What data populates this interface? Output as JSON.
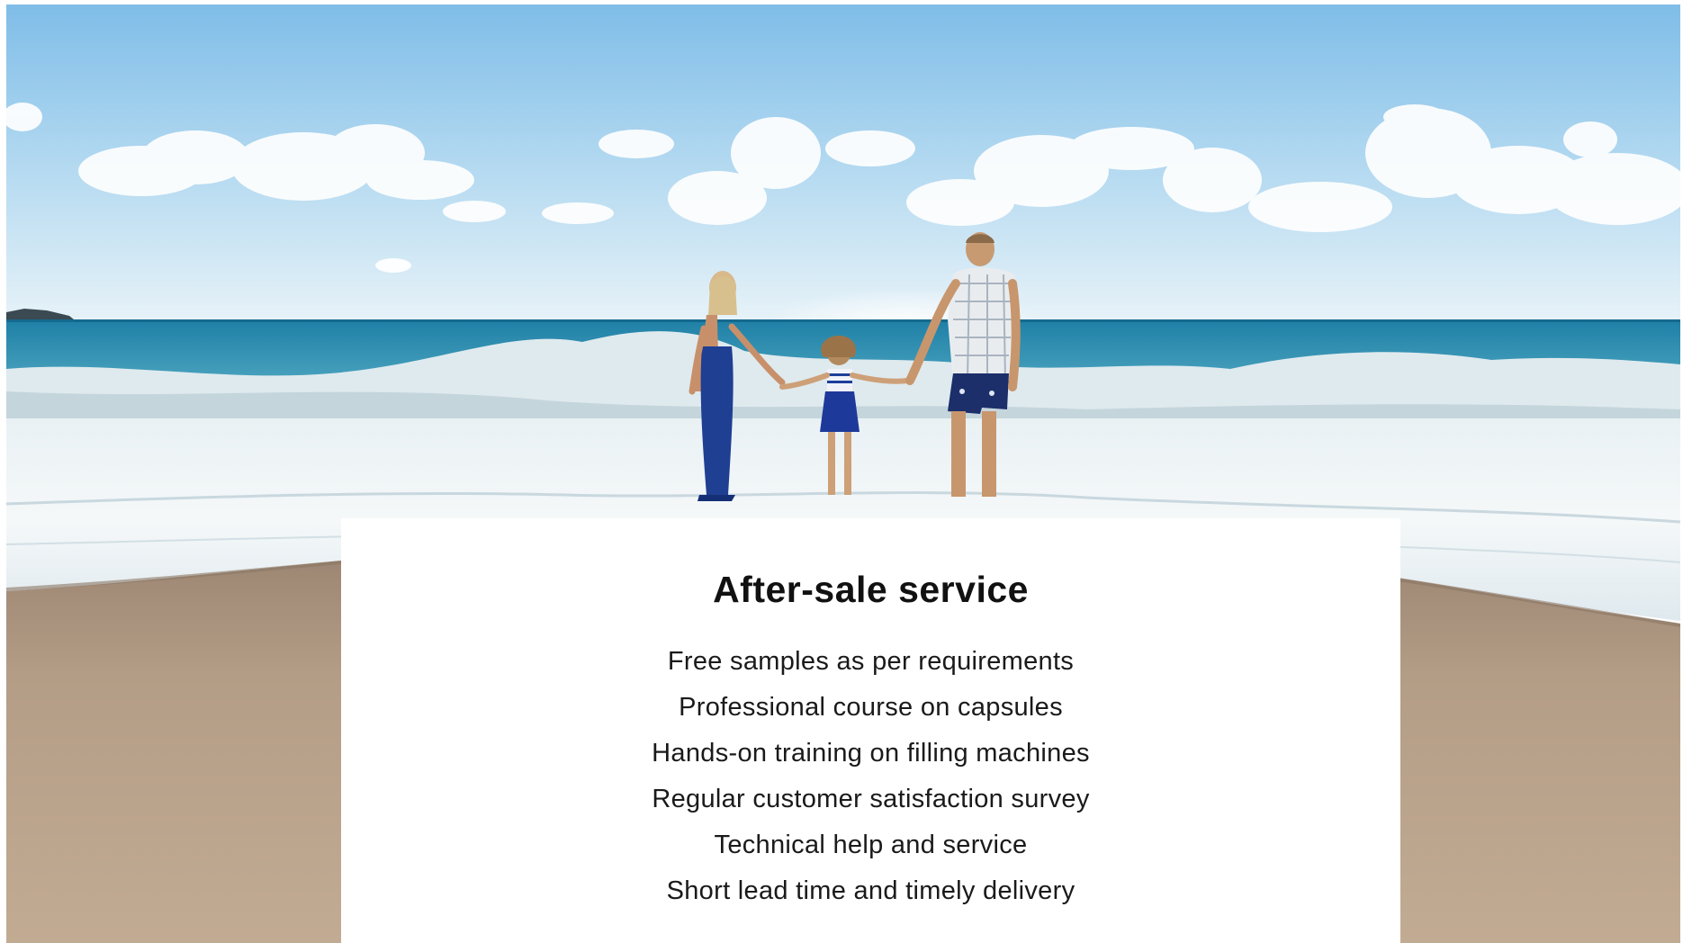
{
  "banner": {
    "image_semantic": "beach-family-photo",
    "colors": {
      "sky_top": "#8cc4ea",
      "sky_horizon": "#e4f1f8",
      "sea": "#2f8fb2",
      "foam": "#f2f6f8",
      "sand": "#b59e86"
    }
  },
  "card": {
    "title": "After-sale service",
    "items": [
      "Free samples as per requirements",
      "Professional course on capsules",
      "Hands-on training on filling machines",
      "Regular customer satisfaction survey",
      "Technical help and service",
      "Short lead time and timely delivery"
    ]
  }
}
